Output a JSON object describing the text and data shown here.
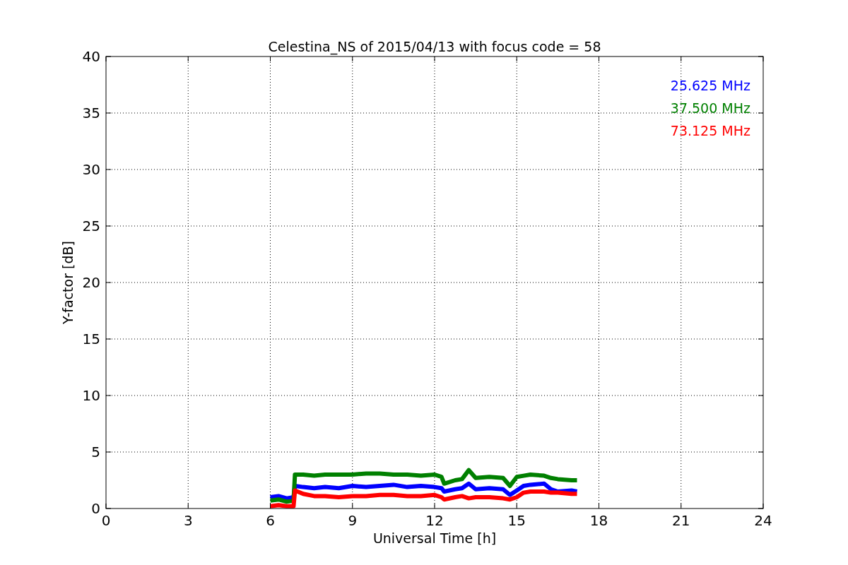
{
  "chart_data": {
    "type": "line",
    "title": "Celestina_NS of 2015/04/13 with focus code = 58",
    "xlabel": "Universal Time [h]",
    "ylabel": "Y-factor [dB]",
    "x": [
      6,
      6.3,
      6.6,
      6.85,
      6.9,
      7.2,
      7.6,
      8,
      8.5,
      9,
      9.5,
      10,
      10.5,
      11,
      11.5,
      12,
      12.25,
      12.35,
      12.75,
      13,
      13.25,
      13.5,
      14,
      14.5,
      14.75,
      15,
      15.25,
      15.5,
      16,
      16.25,
      16.5,
      17,
      17.2
    ],
    "series": [
      {
        "name": "25.625 MHz",
        "color": "#0000ff",
        "values": [
          1.0,
          1.1,
          0.9,
          1.0,
          2.0,
          1.9,
          1.8,
          1.9,
          1.8,
          2.0,
          1.9,
          2.0,
          2.1,
          1.9,
          2.0,
          1.9,
          1.8,
          1.5,
          1.7,
          1.8,
          2.2,
          1.7,
          1.8,
          1.7,
          1.2,
          1.6,
          2.0,
          2.1,
          2.2,
          1.7,
          1.5,
          1.6,
          1.5
        ]
      },
      {
        "name": "37.500 MHz",
        "color": "#008000",
        "values": [
          0.7,
          0.8,
          0.6,
          0.7,
          3.0,
          3.0,
          2.9,
          3.0,
          3.0,
          3.0,
          3.1,
          3.1,
          3.0,
          3.0,
          2.9,
          3.0,
          2.8,
          2.2,
          2.5,
          2.6,
          3.4,
          2.7,
          2.8,
          2.7,
          2.0,
          2.8,
          2.9,
          3.0,
          2.9,
          2.7,
          2.6,
          2.5,
          2.5
        ]
      },
      {
        "name": "73.125 MHz",
        "color": "#ff0000",
        "values": [
          0.2,
          0.3,
          0.2,
          0.2,
          1.6,
          1.3,
          1.1,
          1.1,
          1.0,
          1.1,
          1.1,
          1.2,
          1.2,
          1.1,
          1.1,
          1.2,
          1.0,
          0.8,
          1.0,
          1.1,
          0.9,
          1.0,
          1.0,
          0.9,
          0.8,
          1.0,
          1.4,
          1.5,
          1.5,
          1.4,
          1.4,
          1.3,
          1.3
        ]
      }
    ],
    "grid": true,
    "xlim": [
      0,
      24
    ],
    "ylim": [
      0,
      40
    ],
    "xticks": [
      0,
      3,
      6,
      9,
      12,
      15,
      18,
      21,
      24
    ],
    "yticks": [
      0,
      5,
      10,
      15,
      20,
      25,
      30,
      35,
      40
    ]
  }
}
